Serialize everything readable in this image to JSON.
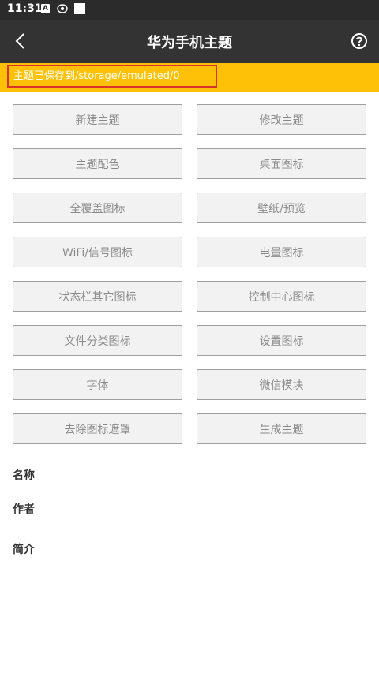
{
  "status_bar": {
    "time": "11:31",
    "icons": [
      "a-notification-icon",
      "eye-icon",
      "white-square-icon"
    ],
    "a_glyph": "A"
  },
  "title_bar": {
    "title": "华为手机主题",
    "back_icon": "chevron-left-icon",
    "help_icon": "question-circle-icon"
  },
  "banner": {
    "message": "主题已保存到/storage/emulated/0",
    "bg_color": "#ffc107",
    "highlight_border": "#d9342b"
  },
  "buttons": [
    {
      "label": "新建主题"
    },
    {
      "label": "修改主题"
    },
    {
      "label": "主题配色"
    },
    {
      "label": "桌面图标"
    },
    {
      "label": "全覆盖图标"
    },
    {
      "label": "壁纸/预览"
    },
    {
      "label": "WiFi/信号图标"
    },
    {
      "label": "电量图标"
    },
    {
      "label": "状态栏其它图标"
    },
    {
      "label": "控制中心图标"
    },
    {
      "label": "文件分类图标"
    },
    {
      "label": "设置图标"
    },
    {
      "label": "字体"
    },
    {
      "label": "微信模块"
    },
    {
      "label": "去除图标遮罩"
    },
    {
      "label": "生成主题"
    }
  ],
  "form": {
    "name_label": "名称",
    "name_value": "",
    "author_label": "作者",
    "author_value": "",
    "intro_label": "简介",
    "intro_value": ""
  },
  "colors": {
    "title_bar": "#333333",
    "status_bar": "#2b2b2b",
    "button_bg": "#f2f2f2",
    "button_text": "#8a8a8a"
  }
}
